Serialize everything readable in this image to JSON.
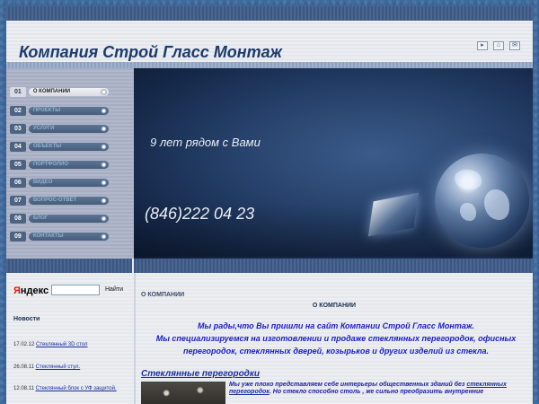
{
  "header": {
    "title": "Компания Строй Гласс Монтаж",
    "icons": [
      "sitemap-icon",
      "home-icon",
      "mail-icon"
    ]
  },
  "nav": {
    "items": [
      {
        "num": "01",
        "label": "О КОМПАНИИ",
        "active": true
      },
      {
        "num": "02",
        "label": "ПРОЕКТЫ"
      },
      {
        "num": "03",
        "label": "УСЛУГИ"
      },
      {
        "num": "04",
        "label": "ОБЪЕКТЫ"
      },
      {
        "num": "05",
        "label": "ПОРТФОЛИО"
      },
      {
        "num": "06",
        "label": "ВИДЕО"
      },
      {
        "num": "07",
        "label": "ВОПРОС-ОТВЕТ"
      },
      {
        "num": "08",
        "label": "БЛОГ"
      },
      {
        "num": "09",
        "label": "КОНТАКТЫ"
      }
    ]
  },
  "banner": {
    "slogan": "9 лет рядом с Вами",
    "phone": "(846)222 04 23"
  },
  "search": {
    "logo_ya": "Я",
    "logo_rest": "ндекс",
    "button": "Найти",
    "value": ""
  },
  "news": {
    "title": "Новости",
    "items": [
      {
        "date": "17.02.12",
        "link": "Стеклянный 3D стол"
      },
      {
        "date": "26.08.11",
        "link": "Стеклянный стул."
      },
      {
        "date": "12.08.11",
        "link": "Стеклянный блок с УФ защитой."
      }
    ]
  },
  "main": {
    "breadcrumb": "О КОМПАНИИ",
    "title": "О КОМПАНИИ",
    "welcome": "Мы рады,что Вы пришли на сайт Компании Строй Гласс Монтаж.",
    "intro": "Мы специализируемся на изготовлении и продаже стеклянных перегородок, офисных перегородок, стеклянных дверей, козырьков и других изделий из стекла.",
    "section": "Стеклянные перегородки",
    "desc_part1": "Мы уже плохо представляем себе интерьеры общественных зданий без ",
    "desc_link1": "стеклянных перегородок",
    "desc_part2": ". Но стекло способно столь , же сильно преобразить внутренние"
  },
  "colors": {
    "accent": "#1d3a6e",
    "link": "#1a2fa0",
    "welcome_text": "#1c1cc8",
    "nav_bar": "#4c6482",
    "page_bg": "#3f6a9e"
  }
}
